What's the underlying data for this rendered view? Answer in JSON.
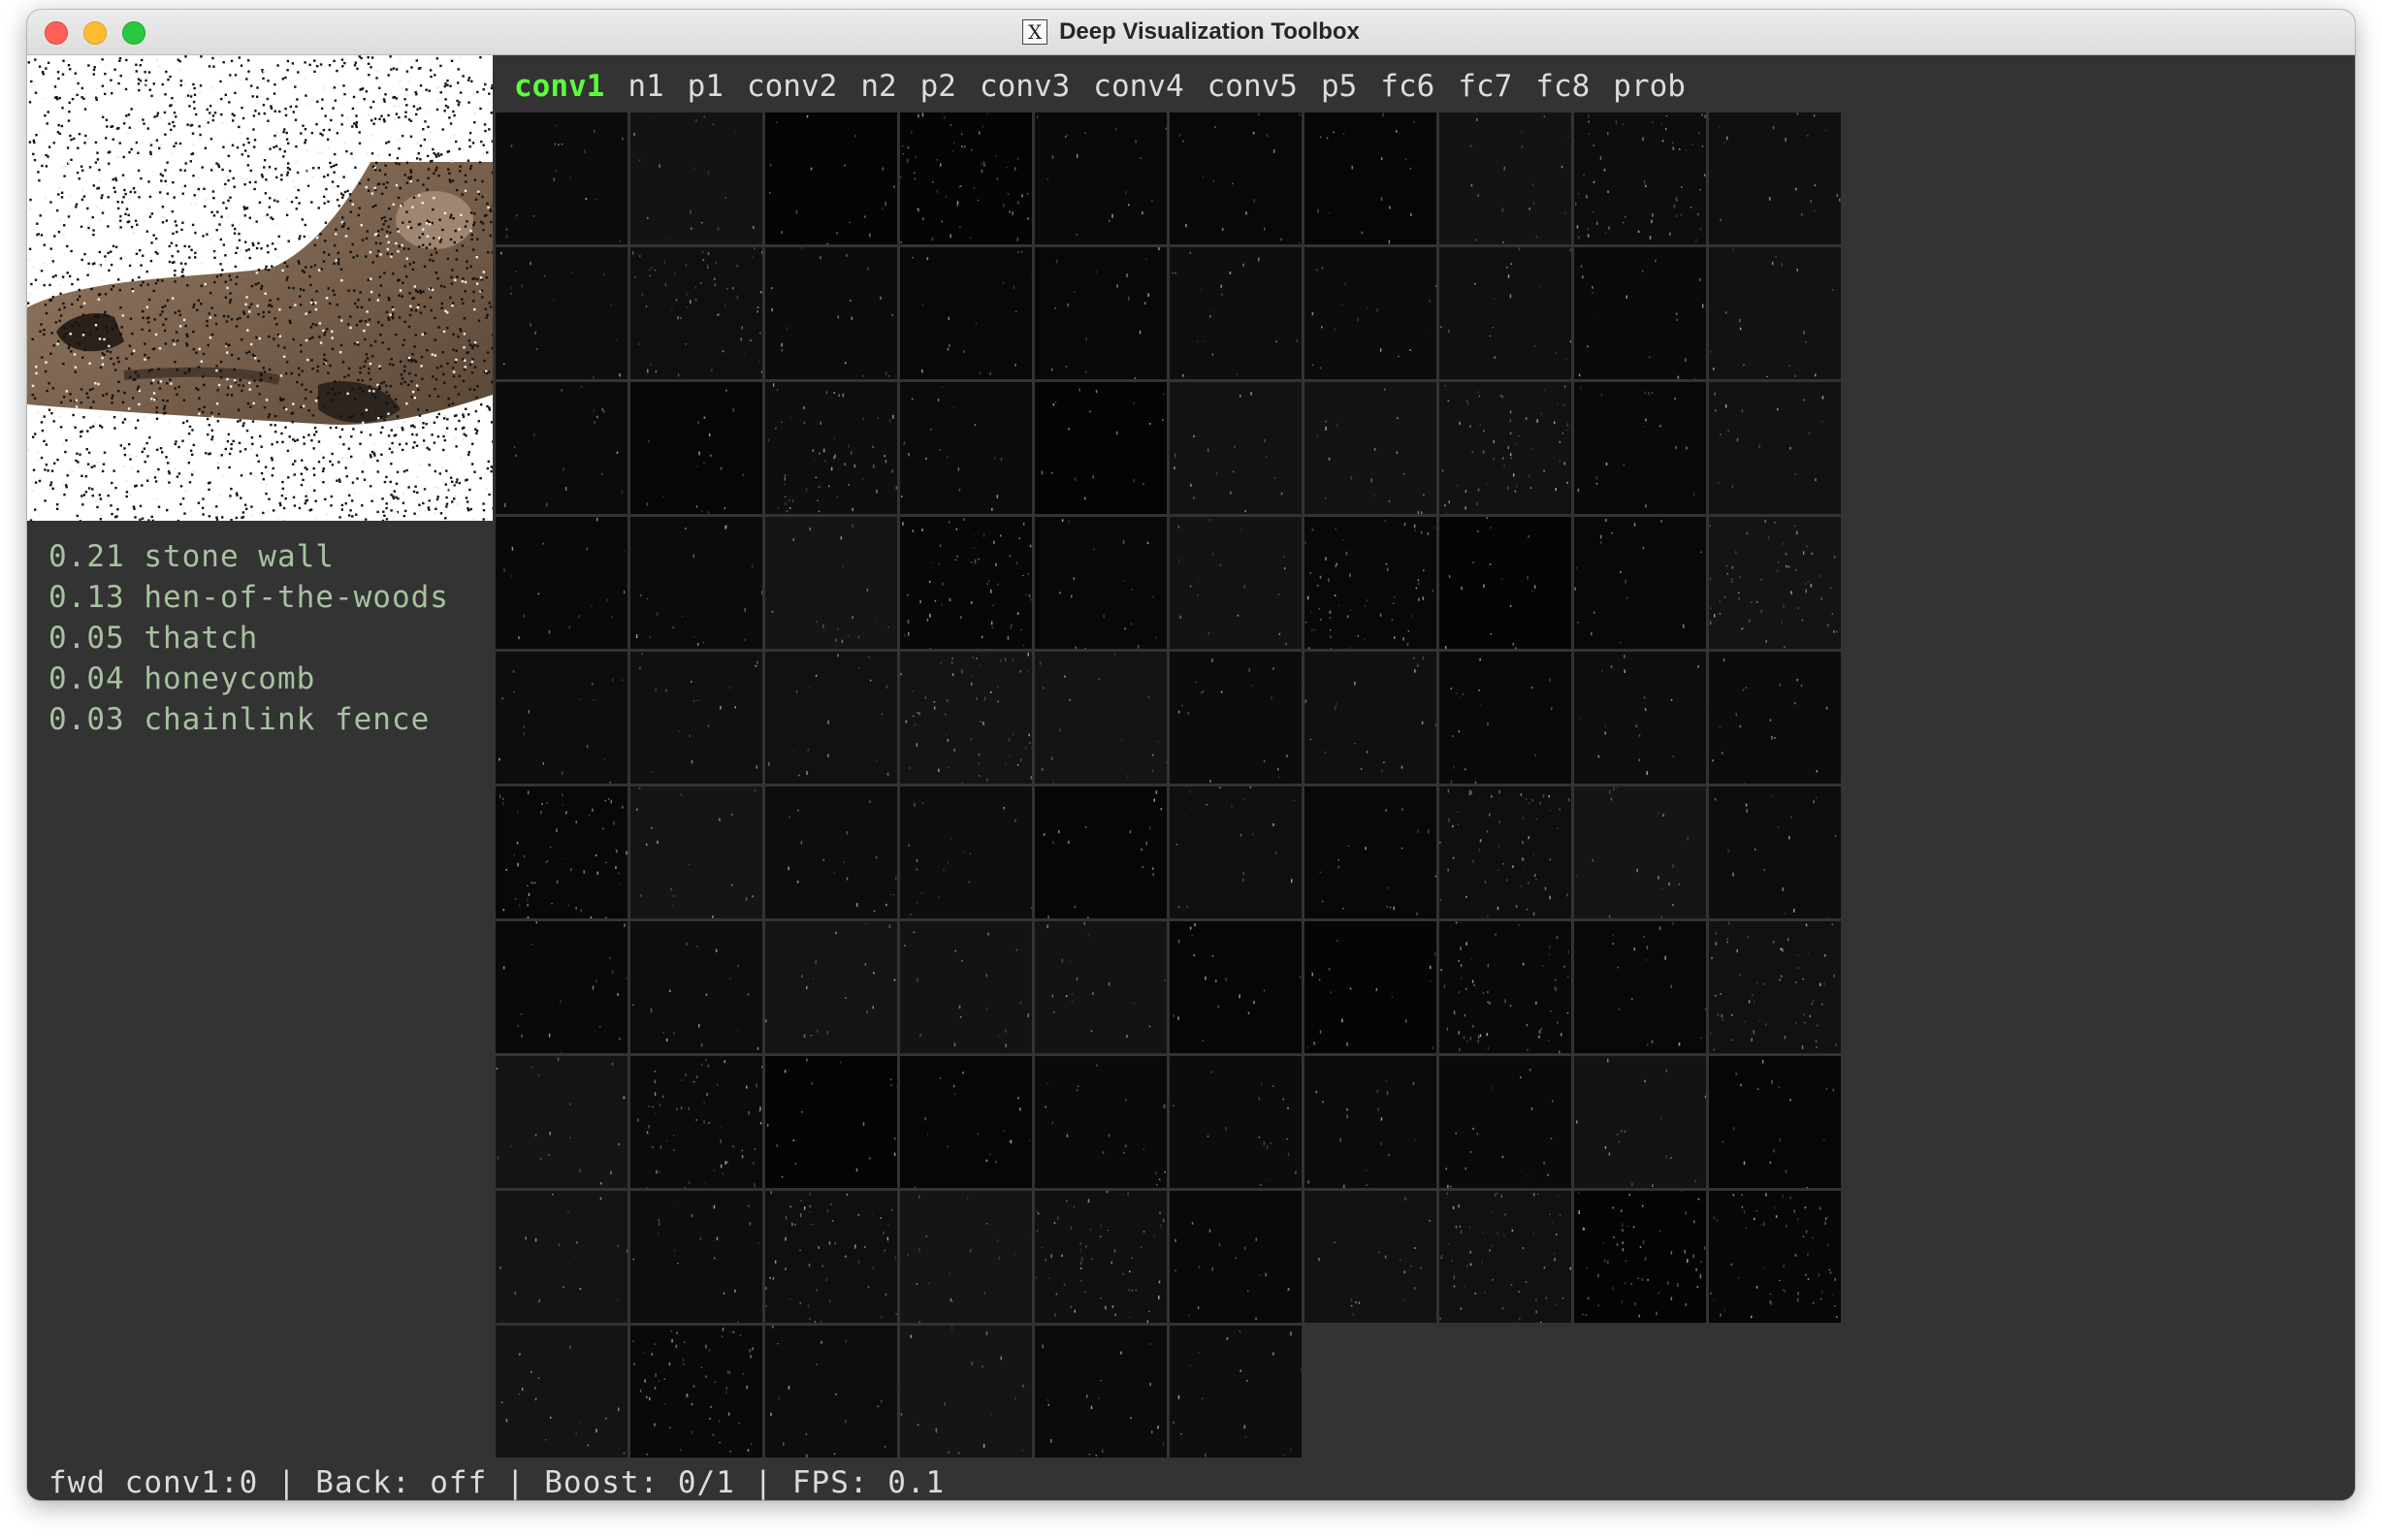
{
  "window": {
    "title": "Deep Visualization Toolbox",
    "app_icon": "x11-icon"
  },
  "layer_tabs": [
    "conv1",
    "n1",
    "p1",
    "conv2",
    "n2",
    "p2",
    "conv3",
    "conv4",
    "conv5",
    "p5",
    "fc6",
    "fc7",
    "fc8",
    "prob"
  ],
  "active_layer": "conv1",
  "predictions": [
    {
      "text": "0.21 stone wall"
    },
    {
      "text": "0.13 hen-of-the-woods"
    },
    {
      "text": "0.05 thatch"
    },
    {
      "text": "0.04 honeycomb"
    },
    {
      "text": "0.03 chainlink fence"
    }
  ],
  "feature_grid": {
    "columns": 10,
    "tile_count": 96
  },
  "status": "fwd conv1:0 | Back: off | Boost: 0/1 | FPS: 0.1",
  "colors": {
    "background": "#333333",
    "active_tab": "#5bff3c",
    "prediction_text": "#a7c2a0",
    "tile": "#0c0c0c"
  }
}
